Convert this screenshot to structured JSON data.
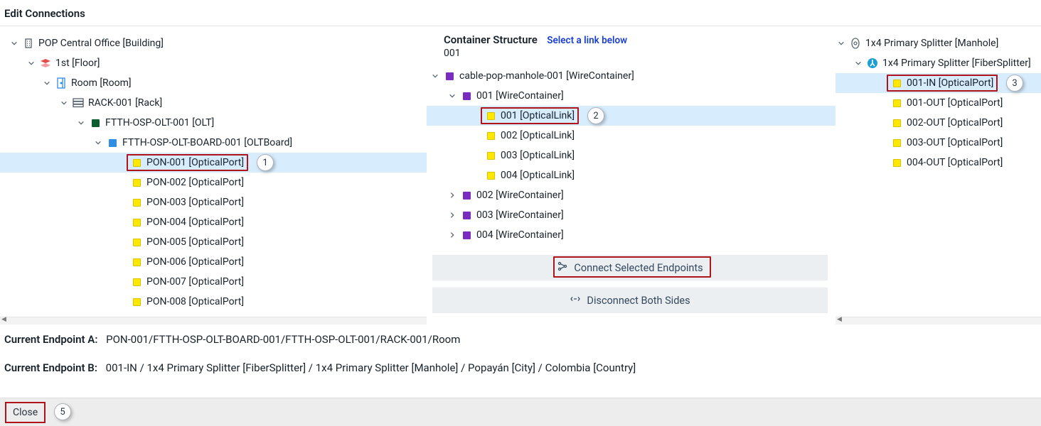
{
  "title": "Edit Connections",
  "center": {
    "title": "Container Structure",
    "hint": "Select a link below",
    "sub": "001"
  },
  "left_tree": [
    {
      "indent": 14,
      "toggle": "down",
      "icon": "building",
      "label": "POP Central Office [Building]"
    },
    {
      "indent": 38,
      "toggle": "down",
      "icon": "floor",
      "label": "1st [Floor]"
    },
    {
      "indent": 60,
      "toggle": "down",
      "icon": "room",
      "label": "Room [Room]"
    },
    {
      "indent": 84,
      "toggle": "down",
      "icon": "rack",
      "label": "RACK-001 [Rack]"
    },
    {
      "indent": 108,
      "toggle": "down",
      "icon": "dgreen",
      "label": "FTTH-OSP-OLT-001 [OLT]"
    },
    {
      "indent": 132,
      "toggle": "down",
      "icon": "blue",
      "label": "FTTH-OSP-OLT-BOARD-001 [OLTBoard]"
    },
    {
      "indent": 166,
      "toggle": "none",
      "icon": "yellow",
      "label": "PON-001 [OpticalPort]",
      "selected": true,
      "hl": true,
      "call": "1"
    },
    {
      "indent": 166,
      "toggle": "none",
      "icon": "yellow",
      "label": "PON-002 [OpticalPort]"
    },
    {
      "indent": 166,
      "toggle": "none",
      "icon": "yellow",
      "label": "PON-003 [OpticalPort]"
    },
    {
      "indent": 166,
      "toggle": "none",
      "icon": "yellow",
      "label": "PON-004 [OpticalPort]"
    },
    {
      "indent": 166,
      "toggle": "none",
      "icon": "yellow",
      "label": "PON-005 [OpticalPort]"
    },
    {
      "indent": 166,
      "toggle": "none",
      "icon": "yellow",
      "label": "PON-006 [OpticalPort]"
    },
    {
      "indent": 166,
      "toggle": "none",
      "icon": "yellow",
      "label": "PON-007 [OpticalPort]"
    },
    {
      "indent": 166,
      "toggle": "none",
      "icon": "yellow",
      "label": "PON-008 [OpticalPort]"
    }
  ],
  "center_tree": [
    {
      "indent": 6,
      "toggle": "down",
      "icon": "purple",
      "label": "cable-pop-manhole-001 [WireContainer]"
    },
    {
      "indent": 30,
      "toggle": "down",
      "icon": "purple",
      "label": "001 [WireContainer]"
    },
    {
      "indent": 64,
      "toggle": "none",
      "icon": "yellow",
      "label": "001 [OpticalLink]",
      "selected": true,
      "hl": true,
      "call": "2"
    },
    {
      "indent": 64,
      "toggle": "none",
      "icon": "yellow",
      "label": "002 [OpticalLink]"
    },
    {
      "indent": 64,
      "toggle": "none",
      "icon": "yellow",
      "label": "003 [OpticalLink]"
    },
    {
      "indent": 64,
      "toggle": "none",
      "icon": "yellow",
      "label": "004 [OpticalLink]"
    },
    {
      "indent": 30,
      "toggle": "right",
      "icon": "purple",
      "label": "002 [WireContainer]"
    },
    {
      "indent": 30,
      "toggle": "right",
      "icon": "purple",
      "label": "003 [WireContainer]"
    },
    {
      "indent": 30,
      "toggle": "right",
      "icon": "purple",
      "label": "004 [WireContainer]"
    }
  ],
  "right_tree": [
    {
      "indent": 2,
      "toggle": "down",
      "icon": "manhole",
      "label": "1x4 Primary Splitter [Manhole]"
    },
    {
      "indent": 26,
      "toggle": "down",
      "icon": "splitter",
      "label": "1x4 Primary Splitter [FiberSplitter]"
    },
    {
      "indent": 60,
      "toggle": "none",
      "icon": "yellow",
      "label": "001-IN [OpticalPort]",
      "selected": true,
      "hl": true,
      "call": "3"
    },
    {
      "indent": 60,
      "toggle": "none",
      "icon": "yellow",
      "label": "001-OUT [OpticalPort]"
    },
    {
      "indent": 60,
      "toggle": "none",
      "icon": "yellow",
      "label": "002-OUT [OpticalPort]"
    },
    {
      "indent": 60,
      "toggle": "none",
      "icon": "yellow",
      "label": "003-OUT [OpticalPort]"
    },
    {
      "indent": 60,
      "toggle": "none",
      "icon": "yellow",
      "label": "004-OUT [OpticalPort]"
    }
  ],
  "actions": {
    "connect": "Connect Selected Endpoints",
    "connect_call": "4",
    "disconnect": "Disconnect Both Sides"
  },
  "endpoints": {
    "a_label": "Current Endpoint A:",
    "a_value": "PON-001/FTTH-OSP-OLT-BOARD-001/FTTH-OSP-OLT-001/RACK-001/Room",
    "b_label": "Current Endpoint B:",
    "b_value": "001-IN / 1x4 Primary Splitter [FiberSplitter] / 1x4 Primary Splitter [Manhole] / Popayán [City] / Colombia [Country]"
  },
  "footer": {
    "close": "Close",
    "close_call": "5"
  }
}
